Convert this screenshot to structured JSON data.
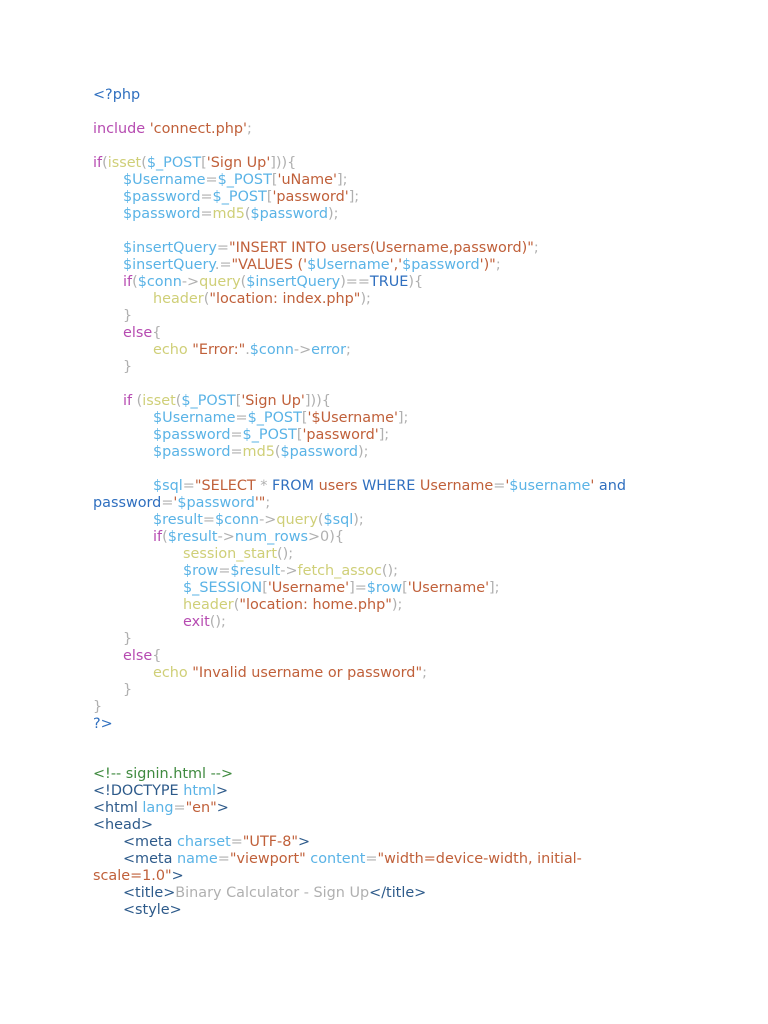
{
  "code": {
    "php_open": "<?php",
    "include_kw": "include",
    "include_file": "'connect.php'",
    "php_close": "?>",
    "lines": {
      "l1_if": "if",
      "l1_isset": "isset",
      "l1_post": "$_POST",
      "l1_key": "'Sign Up'",
      "l2_var": "$Username",
      "l2_post": "$_POST",
      "l2_key": "'uName'",
      "l3_var": "$password",
      "l3_post": "$_POST",
      "l3_key": "'password'",
      "l4_var": "$password",
      "l4_fn": "md5",
      "l4_arg": "$password",
      "l5_var": "$insertQuery",
      "l5_str": "\"INSERT INTO users(Username,password)\"",
      "l6_var": "$insertQuery",
      "l6_str_a": "\"VALUES ('",
      "l6_v1": "$Username",
      "l6_str_b": "','",
      "l6_v2": "$password",
      "l6_str_c": "')\"",
      "l7_if": "if",
      "l7_conn": "$conn",
      "l7_query": "query",
      "l7_arg": "$insertQuery",
      "l7_true": "TRUE",
      "l8_header": "header",
      "l8_str": "\"location: index.php\"",
      "l9_else": "else",
      "l10_echo": "echo",
      "l10_str": "\"Error:\"",
      "l10_conn": "$conn",
      "l10_err": "error",
      "l11_if": "if",
      "l11_isset": "isset",
      "l11_post": "$_POST",
      "l11_key": "'Sign Up'",
      "l12_var": "$Username",
      "l12_post": "$_POST",
      "l12_key": "'$Username'",
      "l13_var": "$password",
      "l13_post": "$_POST",
      "l13_key": "'password'",
      "l14_var": "$password",
      "l14_fn": "md5",
      "l14_arg": "$password",
      "l15_var": "$sql",
      "l15_str_a": "\"SELECT ",
      "l15_star": "*",
      "l15_from": " FROM ",
      "l15_users": "users",
      "l15_where": " WHERE ",
      "l15_col": "Username",
      "l15_q1": "'",
      "l15_v1": "$username",
      "l15_q2": "'",
      "l15_and": " and",
      "l16_col": "password",
      "l16_q1": "'",
      "l16_v2": "$password",
      "l16_q2": "'\"",
      "l17_var": "$result",
      "l17_conn": "$conn",
      "l17_query": "query",
      "l17_arg": "$sql",
      "l18_if": "if",
      "l18_res": "$result",
      "l18_rows": "num_rows",
      "l18_zero": "0",
      "l19_fn": "session_start",
      "l20_var": "$row",
      "l20_res": "$result",
      "l20_fetch": "fetch_assoc",
      "l21_sess": "$_SESSION",
      "l21_key": "'Username'",
      "l21_row": "$row",
      "l21_key2": "'Username'",
      "l22_header": "header",
      "l22_str": "\"location: home.php\"",
      "l23_exit": "exit",
      "l24_else": "else",
      "l25_echo": "echo",
      "l25_str": "\"Invalid username or password\""
    },
    "html": {
      "comment": "<!-- signin.html -->",
      "doctype_open": "<!DOCTYPE",
      "doctype_html": "html",
      "html_tag": "<html",
      "lang_attr": "lang",
      "lang_val": "\"en\"",
      "head_tag": "<head>",
      "meta1_tag": "<meta",
      "charset_attr": "charset",
      "charset_val": "\"UTF-8\"",
      "meta2_tag": "<meta",
      "name_attr": "name",
      "name_val": "\"viewport\"",
      "content_attr": "content",
      "content_val_a": "\"width=device-width, initial-",
      "content_val_b": "scale=1.0\"",
      "title_open": "<title>",
      "title_text": "Binary Calculator - Sign Up",
      "title_close": "</title>",
      "style_tag": "<style>"
    }
  }
}
